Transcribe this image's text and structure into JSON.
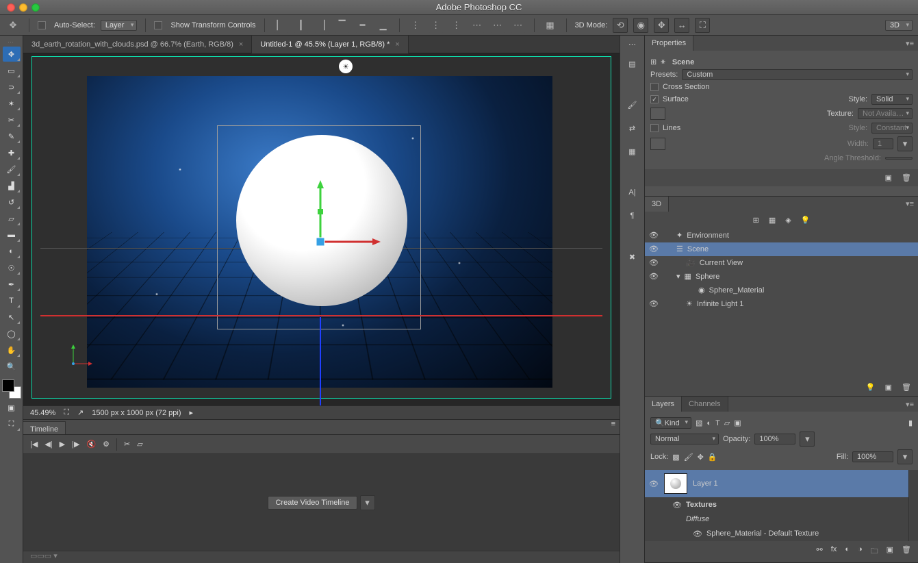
{
  "app": {
    "title": "Adobe Photoshop CC"
  },
  "options": {
    "autoSelectLabel": "Auto-Select:",
    "autoSelectTarget": "Layer",
    "showTransformLabel": "Show Transform Controls",
    "threeDModeLabel": "3D Mode:",
    "rightSelector": "3D"
  },
  "tabs": [
    {
      "label": "3d_earth_rotation_with_clouds.psd @ 66.7% (Earth, RGB/8)",
      "active": false,
      "dirty": false
    },
    {
      "label": "Untitled-1 @ 45.5% (Layer 1, RGB/8) *",
      "active": true,
      "dirty": true
    }
  ],
  "status": {
    "zoom": "45.49%",
    "docinfo": "1500 px x 1000 px (72 ppi)"
  },
  "timeline": {
    "title": "Timeline",
    "button": "Create Video Timeline"
  },
  "properties": {
    "title": "Properties",
    "sceneLabel": "Scene",
    "presetsLabel": "Presets:",
    "presetValue": "Custom",
    "crossSection": "Cross Section",
    "surface": "Surface",
    "styleLabel": "Style:",
    "styleValue": "Solid",
    "textureLabel": "Texture:",
    "textureValue": "Not Availa…",
    "lines": "Lines",
    "lineStyleValue": "Constant",
    "widthLabel": "Width:",
    "widthValue": "1",
    "angleLabel": "Angle Threshold:"
  },
  "threeD": {
    "title": "3D",
    "items": [
      {
        "name": "Environment",
        "depth": 0,
        "icon": "✦"
      },
      {
        "name": "Scene",
        "depth": 0,
        "icon": "☰",
        "selected": true
      },
      {
        "name": "Current View",
        "depth": 1,
        "icon": "🎥"
      },
      {
        "name": "Sphere",
        "depth": 0,
        "icon": "▦",
        "expand": "▾"
      },
      {
        "name": "Sphere_Material",
        "depth": 2,
        "icon": "◉"
      },
      {
        "name": "Infinite Light 1",
        "depth": 1,
        "icon": "☀"
      }
    ]
  },
  "layers": {
    "tabs": [
      "Layers",
      "Channels"
    ],
    "kind": "Kind",
    "blend": "Normal",
    "opacityLabel": "Opacity:",
    "opacity": "100%",
    "lockLabel": "Lock:",
    "fillLabel": "Fill:",
    "fill": "100%",
    "layer1": "Layer 1",
    "textures": "Textures",
    "diffuse": "Diffuse",
    "material": "Sphere_Material - Default Texture"
  }
}
